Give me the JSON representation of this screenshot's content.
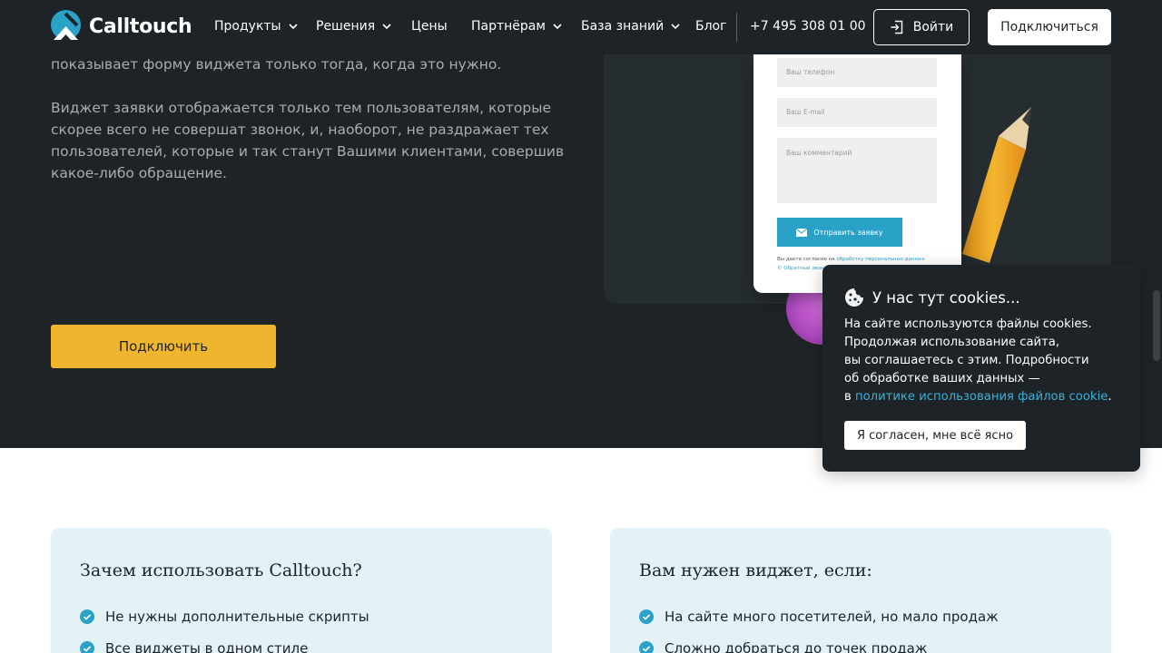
{
  "header": {
    "logo_text": "Calltouch",
    "nav": [
      {
        "label": "Продукты",
        "has_dropdown": true
      },
      {
        "label": "Решения",
        "has_dropdown": true
      },
      {
        "label": "Цены",
        "has_dropdown": false
      },
      {
        "label": "Партнёрам",
        "has_dropdown": true
      },
      {
        "label": "База знаний",
        "has_dropdown": true
      },
      {
        "label": "Блог",
        "has_dropdown": false
      }
    ],
    "phone": "+7 495 308 01 00",
    "login_label": "Войти",
    "connect_label": "Подключиться"
  },
  "hero": {
    "paragraph1_tail": "показывает форму виджета только тогда, когда это нужно.",
    "paragraph2": "Виджет заявки отображается только тем пользователям, которые скорее всего не совершат звонок, и, наоборот, не раздражает тех пользователей, которые и так станут Вашими клиентами, совершив какое-либо обращение.",
    "cta_label": "Подключить"
  },
  "widget_form": {
    "phone_placeholder": "Ваш телефон",
    "email_placeholder": "Ваш E-mail",
    "comment_placeholder": "Ваш комментарий",
    "send_label": "Отправить заявку",
    "consent_prefix": "Вы даете согласие на",
    "consent_link": "обработку персональных данных",
    "footer_text": "© Обратный звонок"
  },
  "cookie": {
    "title": "У нас тут cookies...",
    "line1": "На сайте используются файлы cookies.",
    "line2": "Продолжая использование сайта,",
    "line3": "вы соглашаетесь с этим. Подробности",
    "line4": "об обработке ваших данных —",
    "line5_prefix": "в",
    "link_text": "политике использования файлов cookie",
    "line5_suffix": ".",
    "accept_label": "Я согласен, мне всё ясно"
  },
  "cards": {
    "left": {
      "title": "Зачем использовать Calltouch?",
      "items": [
        "Не нужны дополнительные скрипты",
        "Все виджеты в одном стиле"
      ]
    },
    "right": {
      "title": "Вам нужен виджет, если:",
      "items": [
        "На сайте много посетителей, но мало продаж",
        "Сложно добраться до точек продаж"
      ]
    }
  },
  "colors": {
    "dark_bg": "#1d2327",
    "accent_yellow": "#f0b52f",
    "accent_blue": "#2aa2c7",
    "card_bg": "#e3f2f7"
  }
}
